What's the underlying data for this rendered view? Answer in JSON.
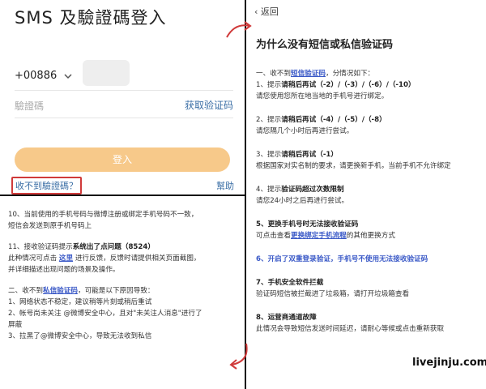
{
  "login": {
    "title": "SMS 及驗證碼登入",
    "country_code": "+00886",
    "code_placeholder": "驗證碼",
    "get_code_label": "获取验证码",
    "login_button_label": "登入",
    "no_code_label": "收不到驗證碼？",
    "help_label": "幫助"
  },
  "info": {
    "back_label": "返回",
    "title": "为什么没有短信或私信验证码",
    "intro_pre": "一、收不到",
    "intro_link": "短信验证码",
    "intro_post": "，分情况如下：",
    "s1_pre": "1、提示",
    "s1_bold": "请稍后再试（-2）/（-3）/（-6）/（-10）",
    "s1_text": "请您使用您所在地当地的手机号进行绑定。",
    "s2_pre": "2、提示",
    "s2_bold": "请稍后再试（-4）/（-5）/（-8）",
    "s2_text": "请您隔几个小时后再进行尝试。",
    "s3_pre": "3、提示",
    "s3_bold": "请稍后再试（-1）",
    "s3_text": "根据国家对实名制的要求，请更换新手机，当前手机不允许绑定",
    "s4_pre": "4、提示",
    "s4_bold": "验证码超过次数限制",
    "s4_text": "请您24小时之后再进行尝试。",
    "s5_title": "5、更换手机号时无法接收验证码",
    "s5_text_pre": "可点击查看",
    "s5_link": "更换绑定手机流程",
    "s5_text_post": "的其他更换方式",
    "s6_title": "6、开启了双重登录验证，手机号不使用无法接收验证码",
    "s7_title": "7、手机安全软件拦截",
    "s7_text": "验证码短信被拦截进了垃圾箱，请打开垃圾箱查看",
    "s8_title": "8、运营商通道故障",
    "s8_text": "此情况会导致短信发送时间延迟，请耐心等候或点击重新获取"
  },
  "reasons": {
    "r10_line1": "10、当前使用的手机号码与微博注册或绑定手机号码不一致，",
    "r10_line2": "短信会发送到原手机号码上",
    "r11_pre": "11、接收验证码提示",
    "r11_bold": "系统出了点问题（8524）",
    "r11_line2_pre": "此种情况可点击 ",
    "r11_link": "这里",
    "r11_line2_post": " 进行反馈，反馈时请提供相关页面截图，",
    "r11_line3": "并详细描述出现问题的场景及操作。",
    "sec2_pre": "二、收不到",
    "sec2_link": "私信验证码",
    "sec2_post": "，可能是以下原因导致：",
    "p1": "1、网络状态不稳定，建议稍等片刻或稍后重试",
    "p2_line1": "2、帐号尚未关注 @微博安全中心，且对\"未关注人消息\"进行了",
    "p2_line2": "屏蔽",
    "p3": "3、拉黑了@微博安全中心，导致无法收到私信"
  },
  "watermark": "livejinju.com",
  "colors": {
    "link_blue": "#3a59c7",
    "button_orange": "#f7c98a",
    "highlight_red": "#d03a3a"
  }
}
